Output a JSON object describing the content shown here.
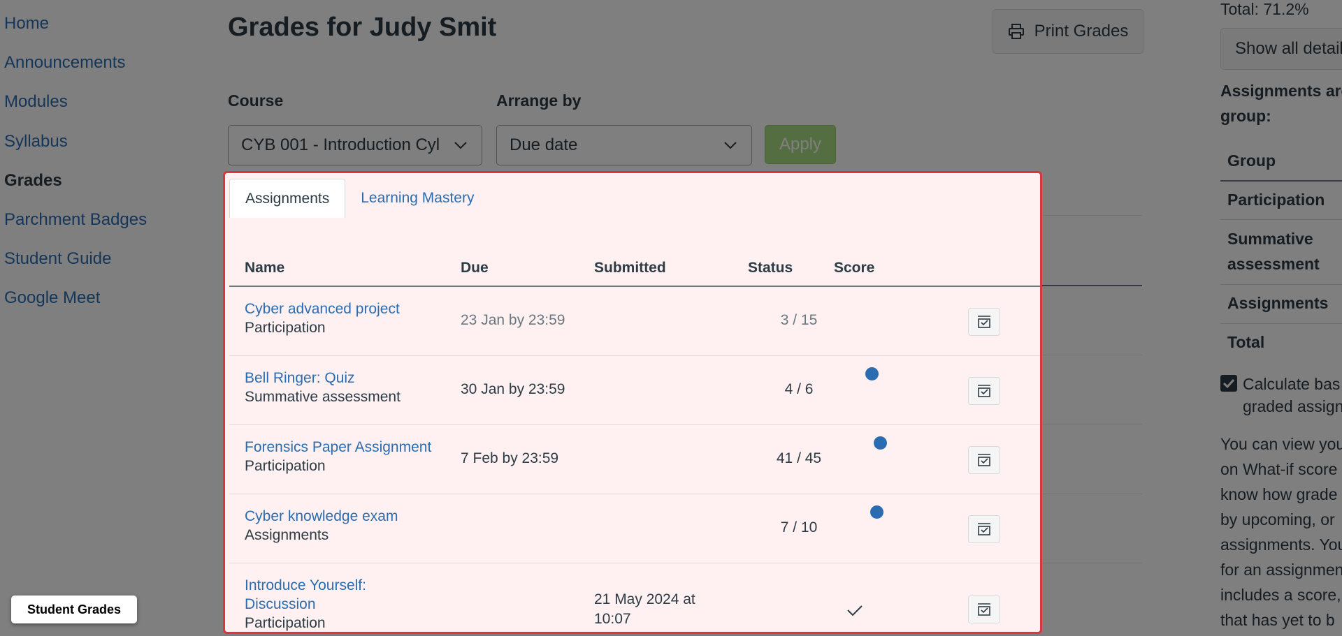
{
  "nav": {
    "items": [
      {
        "label": "Home",
        "active": false
      },
      {
        "label": "Announcements",
        "active": false
      },
      {
        "label": "Modules",
        "active": false
      },
      {
        "label": "Syllabus",
        "active": false
      },
      {
        "label": "Grades",
        "active": true
      },
      {
        "label": "Parchment Badges",
        "active": false
      },
      {
        "label": "Student Guide",
        "active": false
      },
      {
        "label": "Google Meet",
        "active": false
      }
    ]
  },
  "header": {
    "title": "Grades for Judy Smit",
    "print_label": "Print Grades"
  },
  "filters": {
    "course_label": "Course",
    "course_value": "CYB 001 - Introduction Cyl",
    "arrange_label": "Arrange by",
    "arrange_value": "Due date",
    "apply_label": "Apply"
  },
  "tabs": [
    {
      "label": "Assignments",
      "active": true
    },
    {
      "label": "Learning Mastery",
      "active": false
    }
  ],
  "table": {
    "columns": [
      "Name",
      "Due",
      "Submitted",
      "Status",
      "Score"
    ],
    "rows": [
      {
        "name": "Cyber advanced project",
        "group": "Participation",
        "due": "23 Jan by 23:59",
        "submitted": "",
        "status": "",
        "score": "3 / 15",
        "unread": false,
        "muted": true,
        "check": false
      },
      {
        "name": "Bell Ringer: Quiz",
        "group": "Summative assessment",
        "due": "30 Jan by 23:59",
        "submitted": "",
        "status": "",
        "score": "4 / 6",
        "unread": true,
        "muted": false,
        "check": false
      },
      {
        "name": "Forensics Paper Assignment",
        "group": "Participation",
        "due": "7 Feb by 23:59",
        "submitted": "",
        "status": "",
        "score": "41 / 45",
        "unread": true,
        "muted": false,
        "check": false
      },
      {
        "name": "Cyber knowledge exam",
        "group": "Assignments",
        "due": "",
        "submitted": "",
        "status": "",
        "score": "7 / 10",
        "unread": true,
        "muted": false,
        "check": false
      },
      {
        "name": "Introduce Yourself: Discussion",
        "group": "Participation",
        "due": "",
        "submitted": "21 May 2024 at 10:07",
        "status": "",
        "score": "",
        "unread": false,
        "muted": false,
        "check": true
      }
    ]
  },
  "sidebar": {
    "total": "Total: 71.2%",
    "show_all_label": "Show all detail",
    "assignments_heading": "Assignments are group:",
    "group_header": "Group",
    "groups": [
      "Participation",
      "Summative assessment",
      "Assignments",
      "Total"
    ],
    "calc_checkbox_label_1": "Calculate bas",
    "calc_checkbox_label_2": "graded assign",
    "info_lines": [
      "You can view you",
      "on What-if score",
      "know how grade",
      "by upcoming, or",
      "assignments. You",
      "for an assignmen",
      "includes a score,",
      "that has yet to b"
    ]
  },
  "tooltip": {
    "label": "Student Grades"
  },
  "colors": {
    "link": "#2b6cb0",
    "highlight_border": "#d9363e",
    "highlight_bg": "#fff1f1",
    "apply_bg": "#a8dc84",
    "unread_dot": "#2b6cb0"
  }
}
